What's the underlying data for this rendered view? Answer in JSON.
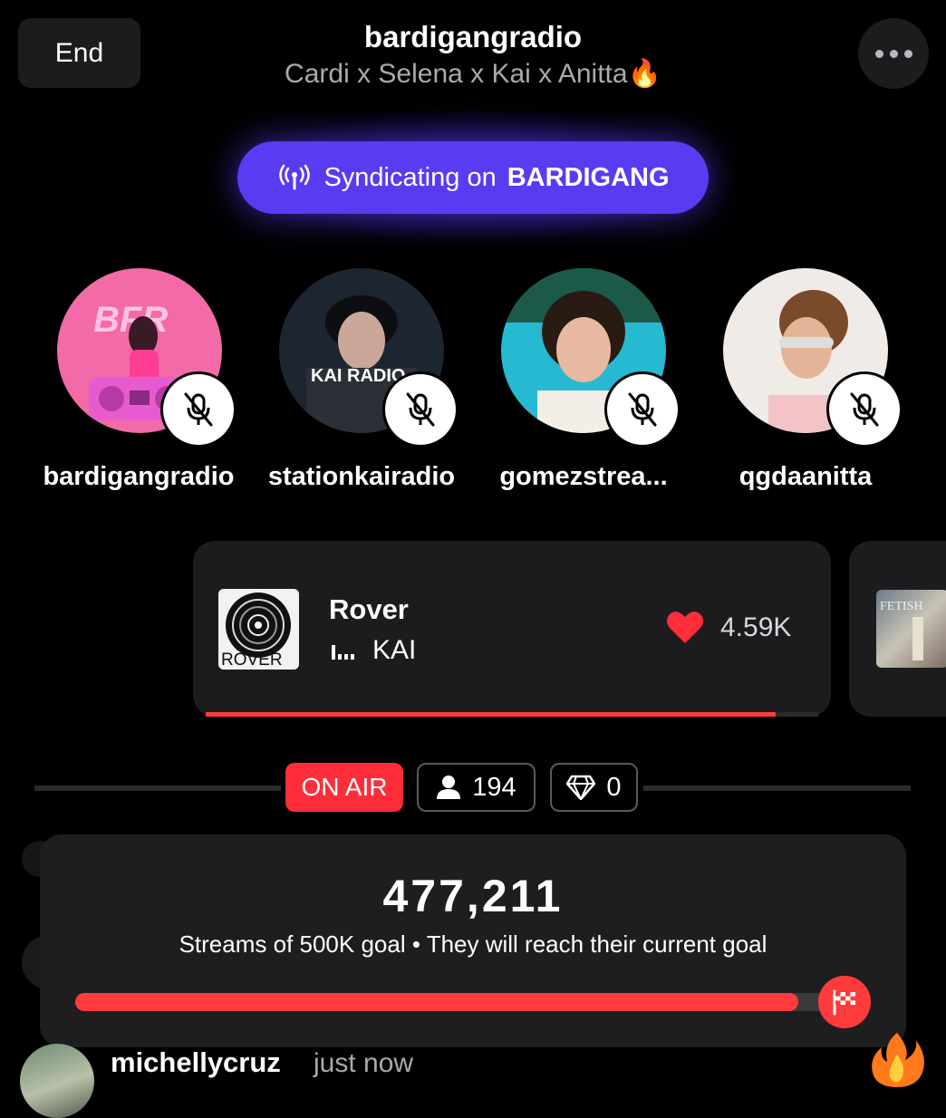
{
  "header": {
    "end_label": "End",
    "title": "bardigangradio",
    "subtitle": "Cardi x Selena x Kai x Anitta🔥"
  },
  "syndicate": {
    "prefix": "Syndicating on",
    "platform": "BARDIGANG",
    "accent": "#5a3bf2"
  },
  "participants": [
    {
      "name": "bardigangradio",
      "icon": "mic-off-icon",
      "avatar_text": "BFR"
    },
    {
      "name": "stationkairadio",
      "icon": "mic-off-icon",
      "avatar_text": "KAI RADIO"
    },
    {
      "name": "gomezstrea...",
      "icon": "mic-off-icon"
    },
    {
      "name": "qgdaanitta",
      "icon": "mic-off-icon"
    }
  ],
  "now_playing": {
    "song": "Rover",
    "artist": "KAI",
    "album_art_text": "ROVER",
    "likes": "4.59K",
    "progress": 0.93,
    "peek_art_text": "FETISH"
  },
  "status": {
    "on_air": "ON AIR",
    "listeners": "194",
    "gems": "0",
    "on_air_color": "#ff2d3a"
  },
  "goal": {
    "count": "477,211",
    "caption": "Streams of 500K goal • They will reach their current goal",
    "progress": 0.954
  },
  "comment": {
    "user": "michellycruz",
    "time": "just now"
  }
}
